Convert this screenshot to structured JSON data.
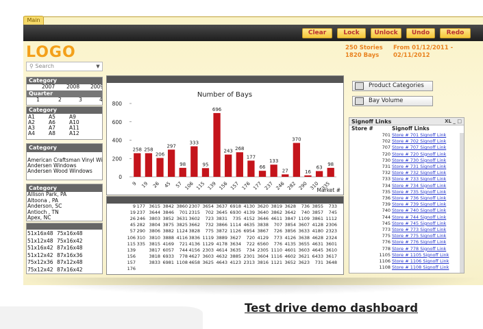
{
  "tab": "Main",
  "toolbar": {
    "clear": "Clear",
    "lock": "Lock",
    "unlock": "Unlock",
    "undo": "Undo",
    "redo": "Redo"
  },
  "logo": "LOGO",
  "stats": {
    "stories": "250 Stories",
    "bays": "1820 Bays"
  },
  "period": {
    "from": "From 01/12/2011 -",
    "to": "02/11/2012"
  },
  "search": {
    "placeholder": "Search"
  },
  "category1": {
    "title": "Category",
    "years": [
      "2007",
      "2008",
      "2009"
    ],
    "quarter_label": "Quarter",
    "quarters": [
      "1",
      "2",
      "3",
      "4"
    ]
  },
  "category2": {
    "title": "Category",
    "rows": [
      [
        "A1",
        "A5",
        "A9"
      ],
      [
        "A2",
        "A6",
        "A10"
      ],
      [
        "A3",
        "A7",
        "A11"
      ],
      [
        "A4",
        "A8",
        "A12"
      ]
    ]
  },
  "category3": {
    "title": "Category",
    "items": [
      "American Craftsman Vinyl Windows",
      "Andersen Windows",
      "Andersen Wood Windows"
    ]
  },
  "category4": {
    "title": "Category",
    "items": [
      "Allison Park, PA",
      "Altoona , PA",
      "Anderson, SC",
      "Antioch , TN",
      "Apex, NC"
    ]
  },
  "sizes": [
    [
      "51x16x48",
      "75x16x48"
    ],
    [
      "51x12x48",
      "75x16x42"
    ],
    [
      "51x16x42",
      "87x16x48"
    ],
    [
      "51x12x42",
      "87x16x36"
    ],
    [
      "75x12x36",
      "87x12x48"
    ],
    [
      "75x12x42",
      "87x16x42"
    ]
  ],
  "chart_data": {
    "type": "bar",
    "title": "Number of Bays",
    "xlabel": "Market #",
    "ylabel": "",
    "ylim": [
      0,
      800
    ],
    "yticks": [
      0,
      200,
      400,
      600,
      800
    ],
    "categories": [
      "9",
      "19",
      "26",
      "45",
      "57",
      "106",
      "115",
      "139",
      "156",
      "157",
      "176",
      "177",
      "237",
      "246",
      "282",
      "290",
      "310",
      "335"
    ],
    "values": [
      258,
      258,
      206,
      297,
      98,
      333,
      95,
      696,
      243,
      268,
      177,
      66,
      133,
      27,
      370,
      16,
      63,
      98
    ],
    "color": "#c4141b"
  },
  "table": {
    "rows": [
      [
        "9",
        "177",
        "3615",
        "3842",
        "3860",
        "2307",
        "3654",
        "3637",
        "6918",
        "4130",
        "3620",
        "3819",
        "3628",
        "736",
        "3855",
        "733"
      ],
      [
        "19",
        "237",
        "3644",
        "3846",
        "701",
        "2315",
        "702",
        "3645",
        "6930",
        "4139",
        "3640",
        "3862",
        "3642",
        "740",
        "3857",
        "745"
      ],
      [
        "26",
        "246",
        "3803",
        "3852",
        "3631",
        "3602",
        "723",
        "3831",
        "735",
        "4152",
        "3646",
        "4611",
        "3847",
        "1109",
        "3861",
        "1112"
      ],
      [
        "45",
        "282",
        "3804",
        "3875",
        "3825",
        "3662",
        "732",
        "3866",
        "1114",
        "4635",
        "3838",
        "707",
        "3854",
        "3607",
        "4128",
        "2306"
      ],
      [
        "57",
        "290",
        "3806",
        "3882",
        "1124",
        "3828",
        "775",
        "3872",
        "1126",
        "6954",
        "3867",
        "726",
        "3856",
        "3633",
        "4180",
        "2323"
      ],
      [
        "106",
        "310",
        "3810",
        "3888",
        "4116",
        "3836",
        "1119",
        "3889",
        "3627",
        "720",
        "4129",
        "773",
        "4126",
        "3638",
        "4628",
        "2324"
      ],
      [
        "115",
        "335",
        "3815",
        "4169",
        "721",
        "4136",
        "1129",
        "4178",
        "3634",
        "722",
        "6560",
        "776",
        "4135",
        "3655",
        "4631",
        "3601"
      ],
      [
        "139",
        "",
        "3817",
        "6057",
        "744",
        "4156",
        "2303",
        "4614",
        "3635",
        "734",
        "2305",
        "1110",
        "4601",
        "3603",
        "4645",
        "3610"
      ],
      [
        "156",
        "",
        "3818",
        "6933",
        "778",
        "4627",
        "3603",
        "4632",
        "3885",
        "2301",
        "3604",
        "1116",
        "4602",
        "3621",
        "6433",
        "3617"
      ],
      [
        "157",
        "",
        "3833",
        "6981",
        "1108",
        "4658",
        "3625",
        "4643",
        "4123",
        "2313",
        "3816",
        "1121",
        "3652",
        "3623",
        "731",
        "3648"
      ],
      [
        "176",
        "",
        "",
        "",
        "",
        "",
        "",
        "",
        "",
        "",
        "",
        "",
        "",
        "",
        "",
        ""
      ]
    ]
  },
  "product_categories": "Product Categories",
  "bay_volume": "Bay Volume",
  "signoff": {
    "title": "Signoff Links",
    "col_store": "Store #",
    "col_link": "Signoff Links",
    "icons": "XL _ □",
    "rows": [
      [
        "701",
        "Store # 701 Signoff Link"
      ],
      [
        "702",
        "Store # 702 Signoff Link"
      ],
      [
        "707",
        "Store # 707 Signoff Link"
      ],
      [
        "720",
        "Store # 720 Signoff Link"
      ],
      [
        "730",
        "Store # 730 Signoff Link"
      ],
      [
        "731",
        "Store # 731 Signoff Link"
      ],
      [
        "732",
        "Store # 732 Signoff Link"
      ],
      [
        "733",
        "Store # 733 Signoff Link"
      ],
      [
        "734",
        "Store # 734 Signoff Link"
      ],
      [
        "735",
        "Store # 735 Signoff Link"
      ],
      [
        "736",
        "Store # 736 Signoff Link"
      ],
      [
        "739",
        "Store # 739 Signoff Link"
      ],
      [
        "740",
        "Store # 740 Signoff Link"
      ],
      [
        "744",
        "Store # 744 Signoff Link"
      ],
      [
        "745",
        "Store # 745 Signoff Link"
      ],
      [
        "773",
        "Store # 773 Signoff Link"
      ],
      [
        "775",
        "Store # 775 Signoff Link"
      ],
      [
        "776",
        "Store # 776 Signoff Link"
      ],
      [
        "778",
        "Store # 778 Signoff Link"
      ],
      [
        "1105",
        "Store # 1105 Signoff Link"
      ],
      [
        "1106",
        "Store # 1106 Signoff Link"
      ],
      [
        "1108",
        "Store # 1108 Signoff Link"
      ]
    ]
  },
  "demo_link": "Test drive demo dashboard"
}
